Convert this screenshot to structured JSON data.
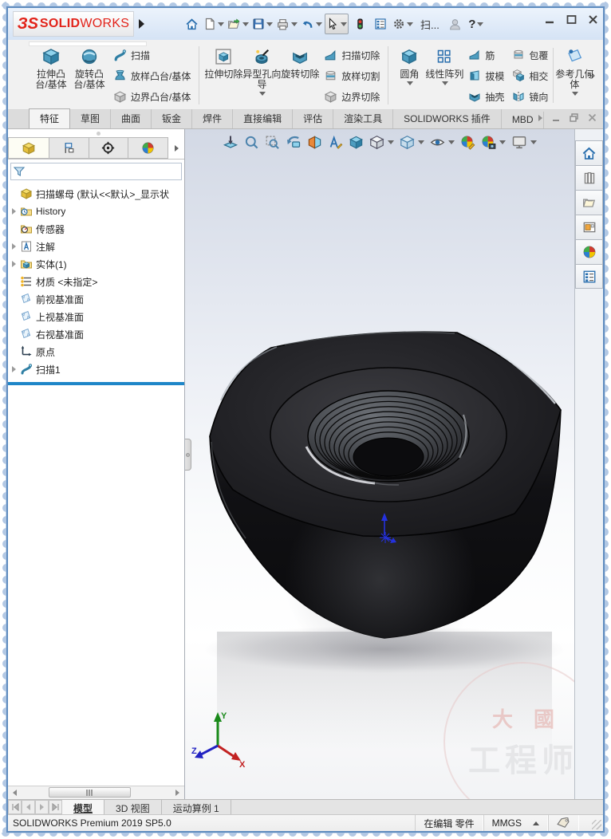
{
  "titlebar": {
    "logo": {
      "mark": "ЗS",
      "solid": "SOLID",
      "works": "WORKS"
    },
    "search_text": "扫...",
    "help_label": "?"
  },
  "ribbon": {
    "tabs": [
      {
        "label": "特征",
        "active": true
      },
      {
        "label": "草图"
      },
      {
        "label": "曲面"
      },
      {
        "label": "钣金"
      },
      {
        "label": "焊件"
      },
      {
        "label": "直接编辑"
      },
      {
        "label": "评估"
      },
      {
        "label": "渲染工具"
      },
      {
        "label": "SOLIDWORKS 插件"
      },
      {
        "label": "MBD"
      }
    ],
    "group1": {
      "big": [
        "拉伸凸台/基体",
        "旋转凸台/基体"
      ],
      "stack": [
        "扫描",
        "放样凸台/基体",
        "边界凸台/基体"
      ]
    },
    "group2": {
      "big": [
        "拉伸切除",
        "异型孔向导",
        "旋转切除"
      ],
      "stack": [
        "扫描切除",
        "放样切割",
        "边界切除"
      ]
    },
    "group3": {
      "big": [
        "圆角",
        "线性阵列"
      ],
      "stack1": [
        "筋",
        "拔模",
        "抽壳"
      ],
      "stack2": [
        "包覆",
        "相交",
        "镜向"
      ],
      "big2": "参考几何体",
      "overflow": "»"
    }
  },
  "feature_tree": {
    "root": "扫描螺母 (默认<<默认>_显示状",
    "items": [
      {
        "label": "History"
      },
      {
        "label": "传感器"
      },
      {
        "label": "注解"
      },
      {
        "label": "实体(1)"
      },
      {
        "label": "材质 <未指定>"
      },
      {
        "label": "前视基准面"
      },
      {
        "label": "上视基准面"
      },
      {
        "label": "右视基准面"
      },
      {
        "label": "原点"
      },
      {
        "label": "扫描1"
      }
    ]
  },
  "viewport": {
    "triad": {
      "x": "X",
      "y": "Y",
      "z": "Z"
    },
    "watermark": {
      "seal": "大國",
      "text": "工程师"
    }
  },
  "doc_tabs": [
    {
      "label": "模型",
      "active": true
    },
    {
      "label": "3D 视图"
    },
    {
      "label": "运动算例 1"
    }
  ],
  "statusbar": {
    "product": "SOLIDWORKS Premium 2019 SP5.0",
    "mode": "在编辑 零件",
    "units": "MMGS"
  },
  "colors": {
    "accent_blue": "#1e86c8",
    "logo_red": "#e2231a",
    "rollback_bar": "#1e86c8"
  }
}
